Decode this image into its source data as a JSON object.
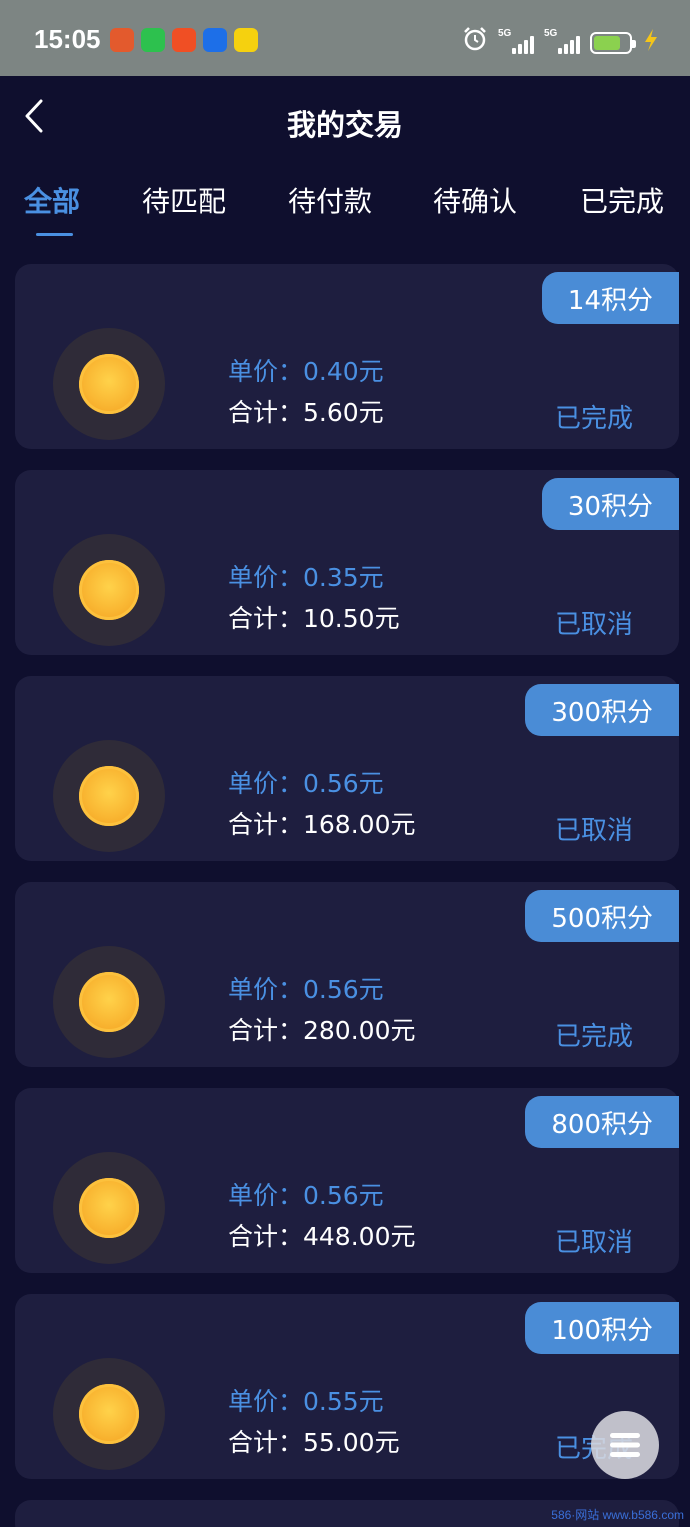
{
  "status_bar": {
    "time": "15:05",
    "signal_1_label": "5G",
    "signal_2_label": "5G",
    "app_icons": [
      {
        "name": "browser-app-icon",
        "color": "#e35a2d"
      },
      {
        "name": "wechat-app-icon",
        "color": "#2dc14e"
      },
      {
        "name": "taobao-app-icon",
        "color": "#f04f24"
      },
      {
        "name": "robot-app-icon",
        "color": "#1d6fe8"
      },
      {
        "name": "yellow-app-icon",
        "color": "#f5d10f"
      }
    ],
    "battery_color": "#8bd14f"
  },
  "header": {
    "title": "我的交易",
    "back_icon": "chevron-left-icon"
  },
  "tabs": [
    {
      "label": "全部",
      "active": true
    },
    {
      "label": "待匹配",
      "active": false
    },
    {
      "label": "待付款",
      "active": false
    },
    {
      "label": "待确认",
      "active": false
    },
    {
      "label": "已完成",
      "active": false
    }
  ],
  "trades": [
    {
      "points": "14积分",
      "unit_price": "单价：0.40元",
      "total": "合计：5.60元",
      "status": "已完成"
    },
    {
      "points": "30积分",
      "unit_price": "单价：0.35元",
      "total": "合计：10.50元",
      "status": "已取消"
    },
    {
      "points": "300积分",
      "unit_price": "单价：0.56元",
      "total": "合计：168.00元",
      "status": "已取消"
    },
    {
      "points": "500积分",
      "unit_price": "单价：0.56元",
      "total": "合计：280.00元",
      "status": "已完成"
    },
    {
      "points": "800积分",
      "unit_price": "单价：0.56元",
      "total": "合计：448.00元",
      "status": "已取消"
    },
    {
      "points": "100积分",
      "unit_price": "单价：0.55元",
      "total": "合计：55.00元",
      "status": "已完成"
    }
  ],
  "floating_menu_icon": "menu-icon",
  "watermark": "586·网站 www.b586.com",
  "colors": {
    "background": "#0f0f2e",
    "card": "#1e1e3f",
    "accent": "#4a90e2",
    "badge": "#4a8cd6",
    "coin": "#f9b632"
  }
}
